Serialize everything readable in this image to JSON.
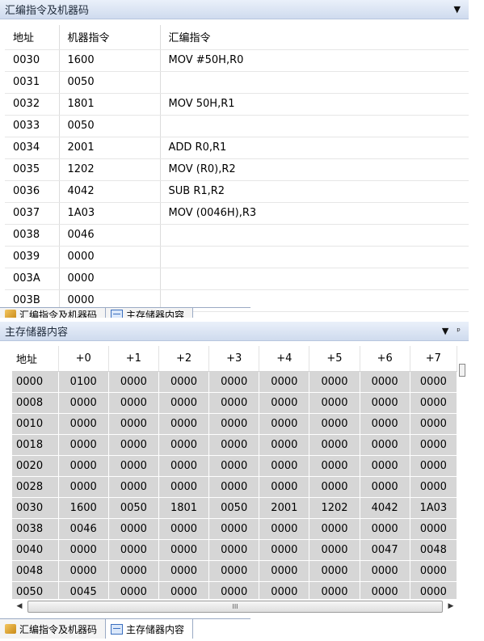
{
  "assembly_panel": {
    "title": "汇编指令及机器码",
    "controls": {
      "dropdown": "▼",
      "pin": "ᵖ"
    },
    "columns": [
      "地址",
      "机器指令",
      "汇编指令"
    ],
    "rows": [
      [
        "0030",
        "1600",
        "MOV #50H,R0"
      ],
      [
        "0031",
        "0050",
        ""
      ],
      [
        "0032",
        "1801",
        "MOV 50H,R1"
      ],
      [
        "0033",
        "0050",
        ""
      ],
      [
        "0034",
        "2001",
        "ADD R0,R1"
      ],
      [
        "0035",
        "1202",
        "MOV (R0),R2"
      ],
      [
        "0036",
        "4042",
        "SUB R1,R2"
      ],
      [
        "0037",
        "1A03",
        "MOV (0046H),R3"
      ],
      [
        "0038",
        "0046",
        ""
      ],
      [
        "0039",
        "0000",
        ""
      ],
      [
        "003A",
        "0000",
        ""
      ],
      [
        "003B",
        "0000",
        ""
      ]
    ]
  },
  "memory_panel": {
    "title": "主存储器内容",
    "controls": {
      "dropdown": "▼",
      "pin": "ᵖ"
    },
    "columns": [
      "地址",
      "+0",
      "+1",
      "+2",
      "+3",
      "+4",
      "+5",
      "+6",
      "+7"
    ],
    "rows": [
      [
        "0000",
        "0100",
        "0000",
        "0000",
        "0000",
        "0000",
        "0000",
        "0000",
        "0000"
      ],
      [
        "0008",
        "0000",
        "0000",
        "0000",
        "0000",
        "0000",
        "0000",
        "0000",
        "0000"
      ],
      [
        "0010",
        "0000",
        "0000",
        "0000",
        "0000",
        "0000",
        "0000",
        "0000",
        "0000"
      ],
      [
        "0018",
        "0000",
        "0000",
        "0000",
        "0000",
        "0000",
        "0000",
        "0000",
        "0000"
      ],
      [
        "0020",
        "0000",
        "0000",
        "0000",
        "0000",
        "0000",
        "0000",
        "0000",
        "0000"
      ],
      [
        "0028",
        "0000",
        "0000",
        "0000",
        "0000",
        "0000",
        "0000",
        "0000",
        "0000"
      ],
      [
        "0030",
        "1600",
        "0050",
        "1801",
        "0050",
        "2001",
        "1202",
        "4042",
        "1A03"
      ],
      [
        "0038",
        "0046",
        "0000",
        "0000",
        "0000",
        "0000",
        "0000",
        "0000",
        "0000"
      ],
      [
        "0040",
        "0000",
        "0000",
        "0000",
        "0000",
        "0000",
        "0000",
        "0047",
        "0048"
      ],
      [
        "0048",
        "0000",
        "0000",
        "0000",
        "0000",
        "0000",
        "0000",
        "0000",
        "0000"
      ],
      [
        "0050",
        "0045",
        "0000",
        "0000",
        "0000",
        "0000",
        "0000",
        "0000",
        "0000"
      ]
    ],
    "scrollbar": {
      "left_arrow": "◀",
      "right_arrow": "▶",
      "grip": "III"
    }
  },
  "bottom_tabs": [
    {
      "label": "汇编指令及机器码",
      "icon": "assembly-icon",
      "active": false
    },
    {
      "label": "主存储器内容",
      "icon": "memory-window-icon",
      "active": true
    }
  ],
  "colors": {
    "header_bg": "#dbe4f3",
    "memory_cell_bg": "#d6d6d6"
  }
}
